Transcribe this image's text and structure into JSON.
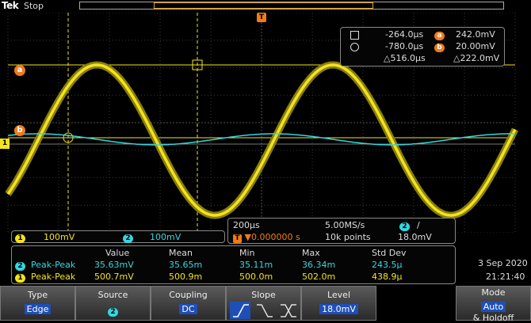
{
  "header": {
    "logo": "Tek",
    "run_state": "Stop"
  },
  "cursor_readout": {
    "a_time": "-264.0µs",
    "a_value": "242.0mV",
    "b_time": "-780.0µs",
    "b_value": "20.00mV",
    "delta_time": "△516.0µs",
    "delta_value": "△222.0mV",
    "a_label": "a",
    "b_label": "b"
  },
  "markers": {
    "trigger": "T",
    "ch1": "1",
    "cursor_a": "a",
    "cursor_b": "b"
  },
  "channels": [
    {
      "num": "1",
      "scale": "100mV",
      "color": "#f3e31c"
    },
    {
      "num": "2",
      "scale": "100mV",
      "color": "#35d6e0"
    }
  ],
  "horizontal": {
    "timebase": "200µs",
    "sample_rate": "5.00MS/s",
    "trigger_source": "2",
    "trigger_slope": "/",
    "trigger_position": "▼0.000000 s",
    "trigger_icon": "T",
    "record_length": "10k points",
    "trigger_level": "18.0mV"
  },
  "measurements": {
    "headers": [
      "Value",
      "Mean",
      "Min",
      "Max",
      "Std Dev"
    ],
    "rows": [
      {
        "ch": "2",
        "name": "Peak-Peak",
        "values": [
          "35.63mV",
          "35.65m",
          "35.11m",
          "36.34m",
          "243.5µ"
        ]
      },
      {
        "ch": "1",
        "name": "Peak-Peak",
        "values": [
          "500.7mV",
          "500.9m",
          "500.0m",
          "502.0m",
          "438.9µ"
        ]
      }
    ]
  },
  "datetime": {
    "date": "3 Sep  2020",
    "time": "21:21:40"
  },
  "menu": {
    "type_label": "Type",
    "type_value": "Edge",
    "source_label": "Source",
    "source_value": "2",
    "coupling_label": "Coupling",
    "coupling_value": "DC",
    "slope_label": "Slope",
    "level_label": "Level",
    "level_value": "18.0mV",
    "mode_label": "Mode",
    "mode_value": "Auto",
    "mode_extra": "& Holdoff"
  },
  "waveform": {
    "ch1_amplitude_mv": 250,
    "ch1_frequency_cycles_per_screen": 2.15,
    "ch2_amplitude_mv": 18,
    "colors": {
      "ch1": "#f3e31c",
      "ch2": "#35d6e0",
      "accent": "#f17b19",
      "select": "#1f4fb6"
    }
  }
}
